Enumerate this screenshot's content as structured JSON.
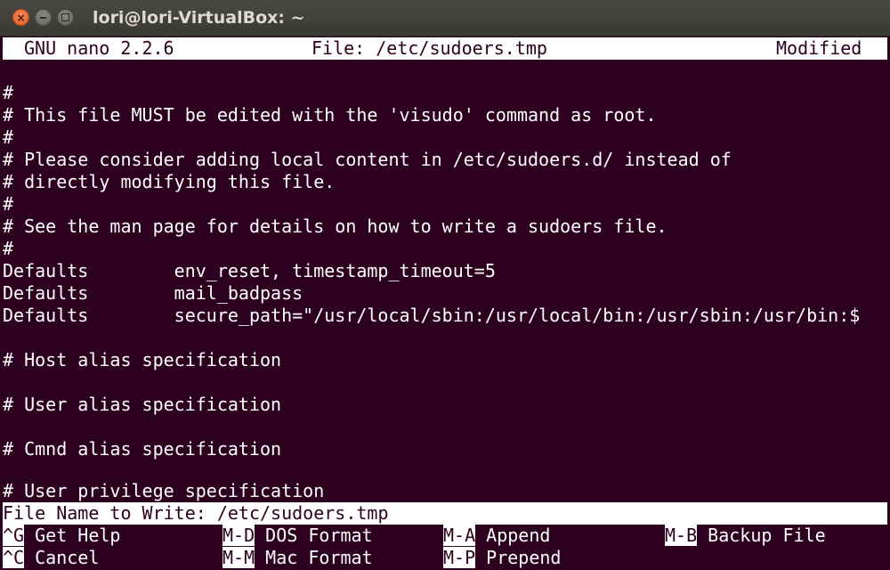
{
  "window": {
    "title": "lori@lori-VirtualBox: ~",
    "close_glyph": "×",
    "min_glyph": "–"
  },
  "nano": {
    "version": "GNU nano 2.2.6",
    "file_label": "File: /etc/sudoers.tmp",
    "status": "Modified"
  },
  "editor": {
    "lines": [
      "#",
      "# This file MUST be edited with the 'visudo' command as root.",
      "#",
      "# Please consider adding local content in /etc/sudoers.d/ instead of",
      "# directly modifying this file.",
      "#",
      "# See the man page for details on how to write a sudoers file.",
      "#",
      "Defaults        env_reset, timestamp_timeout=5",
      "Defaults        mail_badpass",
      "Defaults        secure_path=\"/usr/local/sbin:/usr/local/bin:/usr/sbin:/usr/bin:$",
      "",
      "# Host alias specification",
      "",
      "# User alias specification",
      "",
      "# Cmnd alias specification",
      "",
      "# User privilege specification"
    ]
  },
  "prompt": {
    "label": "File Name to Write: ",
    "value": "/etc/sudoers.tmp"
  },
  "shortcuts": [
    {
      "key": "^G",
      "label": "Get Help"
    },
    {
      "key": "M-D",
      "label": "DOS Format"
    },
    {
      "key": "M-A",
      "label": "Append"
    },
    {
      "key": "M-B",
      "label": "Backup File"
    },
    {
      "key": "^C",
      "label": "Cancel"
    },
    {
      "key": "M-M",
      "label": "Mac Format"
    },
    {
      "key": "M-P",
      "label": "Prepend"
    }
  ],
  "colors": {
    "terminal_bg": "#2c001e",
    "terminal_fg": "#ffffff",
    "close_button": "#e05a1f"
  }
}
